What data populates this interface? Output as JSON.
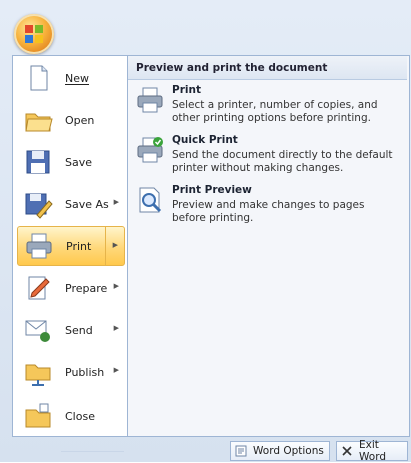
{
  "office_button": {
    "icon": "office-logo-icon"
  },
  "menu": {
    "items": [
      {
        "label": "New",
        "icon": "new-document-icon"
      },
      {
        "label": "Open",
        "icon": "open-folder-icon"
      },
      {
        "label": "Save",
        "icon": "save-disk-icon"
      },
      {
        "label": "Save As",
        "icon": "save-as-icon",
        "has_submenu": true
      },
      {
        "label": "Print",
        "icon": "printer-icon",
        "has_submenu": true,
        "active": true
      },
      {
        "label": "Prepare",
        "icon": "prepare-icon",
        "has_submenu": true
      },
      {
        "label": "Send",
        "icon": "send-icon",
        "has_submenu": true
      },
      {
        "label": "Publish",
        "icon": "publish-icon",
        "has_submenu": true
      },
      {
        "label": "Close",
        "icon": "close-folder-icon"
      }
    ]
  },
  "submenu": {
    "header": "Preview and print the document",
    "options": [
      {
        "title": "Print",
        "description": "Select a printer, number of copies, and other printing options before printing.",
        "icon": "printer-icon"
      },
      {
        "title": "Quick Print",
        "description": "Send the document directly to the default printer without making changes.",
        "icon": "quick-print-icon"
      },
      {
        "title": "Print Preview",
        "description": "Preview and make changes to pages before printing.",
        "icon": "print-preview-icon"
      }
    ]
  },
  "footer": {
    "word_options_label": "Word Options",
    "exit_word_label": "Exit Word"
  },
  "colors": {
    "accent_highlight": "#ffd87a",
    "border": "#9eb5d4"
  }
}
